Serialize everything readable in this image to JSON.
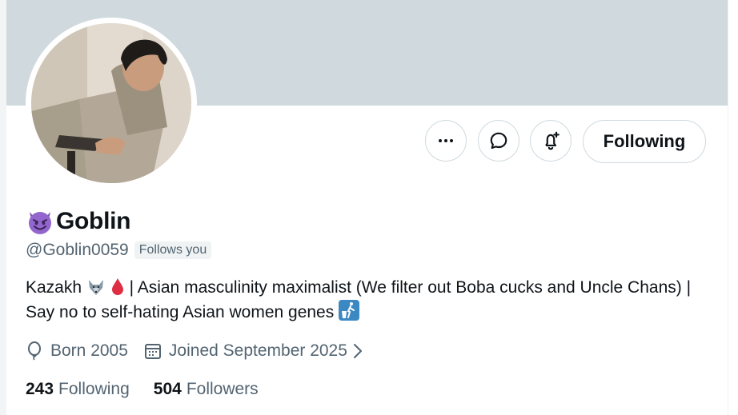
{
  "profile": {
    "display_name": "Goblin",
    "display_name_emoji": "smiling-face-with-horns-emoji",
    "handle": "@Goblin0059",
    "follows_you_badge": "Follows you",
    "bio_part1": "Kazakh",
    "bio_part2": "| Asian masculinity maximalist (We filter out Boba cucks and Uncle Chans) | Say no to self-hating Asian women genes",
    "bio_emojis": [
      "wolf-emoji",
      "drop-of-blood-emoji",
      "put-litter-in-its-place-emoji"
    ],
    "born": "Born 2005",
    "joined": "Joined September 2025",
    "following_count": "243",
    "following_label": "Following",
    "followers_count": "504",
    "followers_label": "Followers"
  },
  "actions": {
    "more_icon": "more-icon",
    "message_icon": "message-icon",
    "notify_icon": "bell-plus-icon",
    "follow_label": "Following"
  },
  "colors": {
    "banner": "#cfd9de",
    "secondary_text": "#536471",
    "primary_text": "#0f1419",
    "border": "#cfd9de"
  }
}
